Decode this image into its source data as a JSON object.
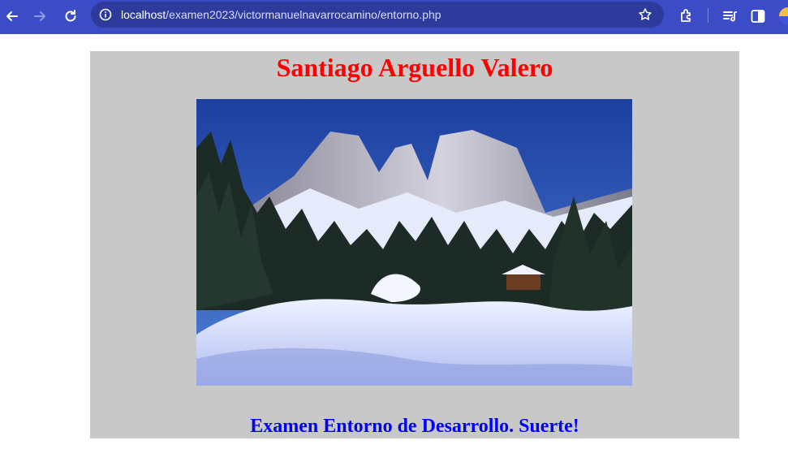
{
  "browser": {
    "url_host": "localhost",
    "url_path": "/examen2023/victormanuelnavarrocamino/entorno.php",
    "icons": [
      "back-arrow-icon",
      "forward-arrow-icon",
      "reload-icon",
      "info-icon",
      "bookmark-star-icon",
      "extensions-icon",
      "reading-list-icon",
      "side-panel-icon",
      "profile-avatar"
    ],
    "toolbar_color": "#3c4cc6"
  },
  "page": {
    "title": "Santiago Arguello Valero",
    "title_color": "#ff0000",
    "image_subject": "snowy-mountain-landscape",
    "footer": "Examen Entorno de Desarrollo. Suerte!",
    "footer_color": "#0000ff",
    "panel_color": "#c8c8c8"
  }
}
